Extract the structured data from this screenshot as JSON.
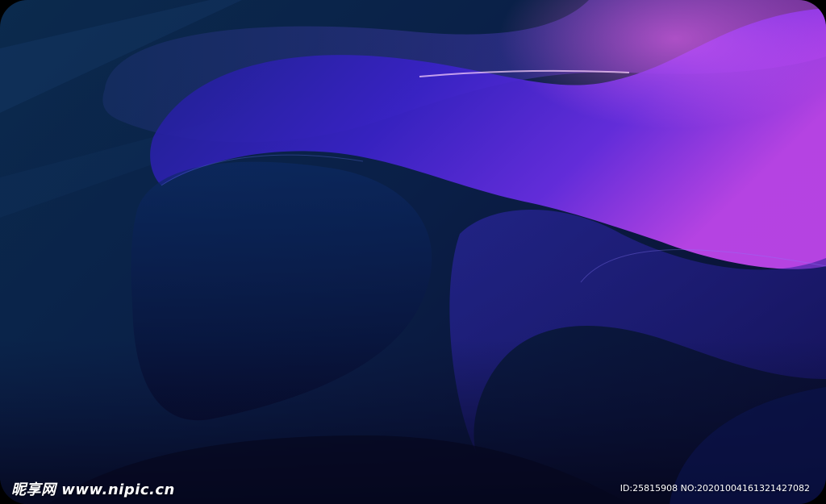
{
  "watermark": {
    "site_text": "昵享网 www.nipic.cn",
    "id_text": "ID:25815908 NO:20201004161321427082"
  },
  "colors": {
    "deep_navy": "#0a1f47",
    "indigo": "#2a1ea8",
    "violet": "#5a2de0",
    "magenta": "#d24af0"
  }
}
